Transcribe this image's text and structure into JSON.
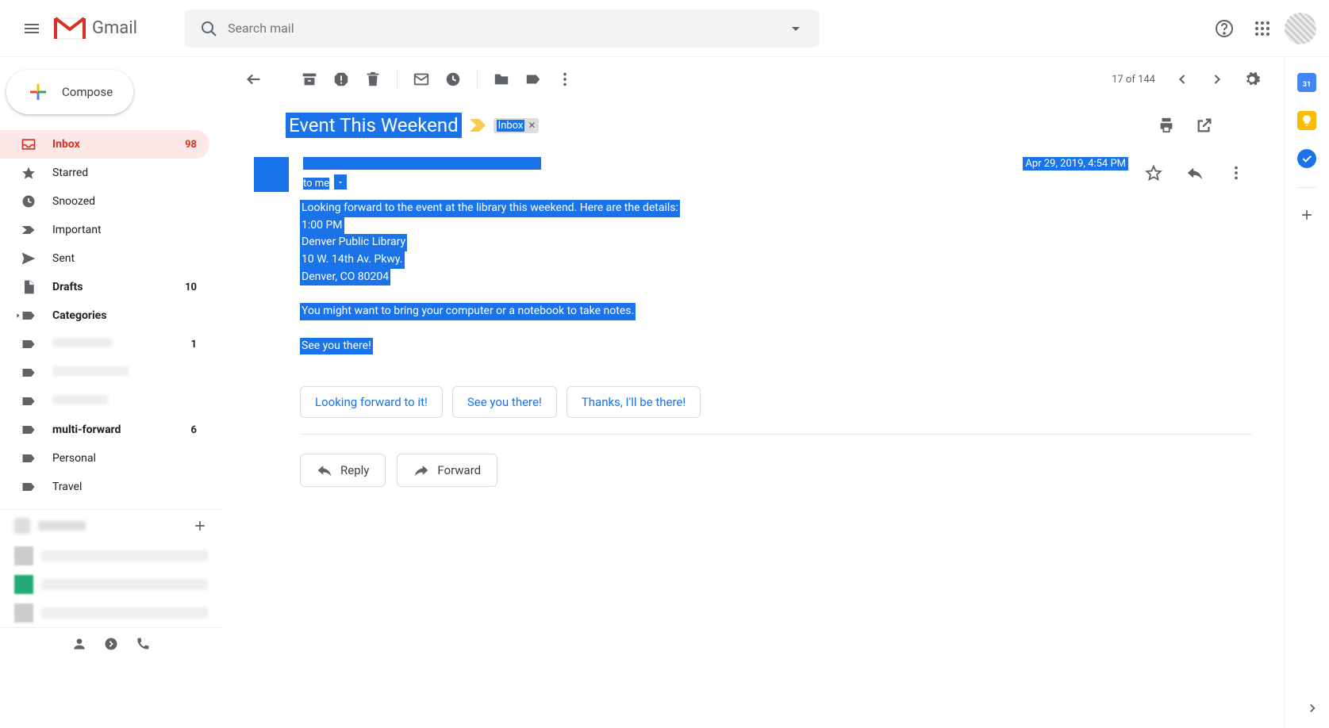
{
  "header": {
    "app_name": "Gmail",
    "search_placeholder": "Search mail"
  },
  "compose": {
    "label": "Compose"
  },
  "sidebar": {
    "items": [
      {
        "icon": "inbox",
        "label": "Inbox",
        "count": "98",
        "active": true,
        "bold": true
      },
      {
        "icon": "star",
        "label": "Starred"
      },
      {
        "icon": "clock",
        "label": "Snoozed"
      },
      {
        "icon": "important",
        "label": "Important"
      },
      {
        "icon": "send",
        "label": "Sent"
      },
      {
        "icon": "drafts",
        "label": "Drafts",
        "count": "10",
        "bold": true
      },
      {
        "icon": "categories",
        "label": "Categories",
        "bold": true,
        "caret": true
      },
      {
        "icon": "label",
        "label": "",
        "count": "1",
        "blur": true
      },
      {
        "icon": "label",
        "label": "",
        "blur": true
      },
      {
        "icon": "label",
        "label": "",
        "blur": true
      },
      {
        "icon": "label",
        "label": "multi-forward",
        "count": "6",
        "bold": true
      },
      {
        "icon": "label",
        "label": "Personal"
      },
      {
        "icon": "label",
        "label": "Travel"
      }
    ]
  },
  "toolbar": {
    "pager": "17 of 144"
  },
  "message": {
    "subject": "Event This Weekend",
    "inbox_chip": "Inbox",
    "timestamp": "Apr 29, 2019, 4:54 PM",
    "to_line": "to me",
    "body_lines": [
      "Looking forward to the event at the library this weekend. Here are the details:",
      "1:00 PM",
      "Denver Public Library",
      "10 W. 14th Av. Pkwy.",
      "Denver, CO 80204",
      "",
      "You might want to bring your computer or a notebook to take notes.",
      "",
      "See you there!"
    ]
  },
  "suggestions": [
    "Looking forward to it!",
    "See you there!",
    "Thanks, I'll be there!"
  ],
  "actions": {
    "reply": "Reply",
    "forward": "Forward"
  }
}
